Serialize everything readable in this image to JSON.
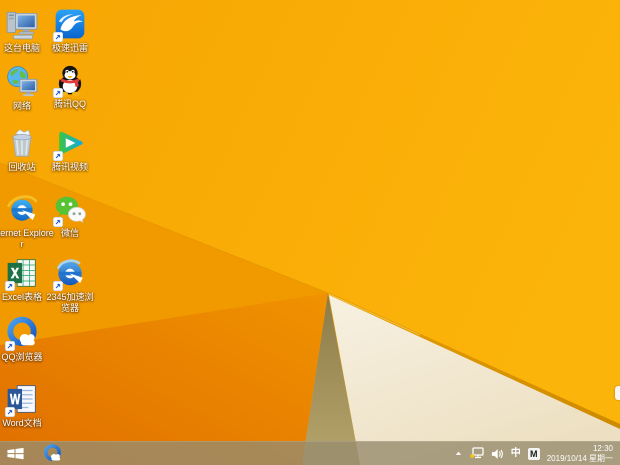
{
  "wallpaper": {
    "base_left": "#F7A502",
    "base_right": "#FBB40A",
    "left_wedge": "#F19A00",
    "left_dark_top": "#F09200",
    "left_dark_bottom": "#E06F00",
    "shadow_top": "#8C7B47",
    "shadow_bottom": "#B7A56D",
    "cream_top": "#F7F1E2",
    "cream_bottom": "#EDE0C2",
    "fold_strip_light": "#E89E00",
    "fold_strip_dark": "#CE8A00"
  },
  "desktop": {
    "icons": [
      {
        "label": "这台电脑",
        "icon": "computer-icon",
        "shortcut": false
      },
      {
        "label": "极速迅雷",
        "icon": "xunlei-icon",
        "shortcut": true
      },
      {
        "label": "网络",
        "icon": "network-icon",
        "shortcut": false
      },
      {
        "label": "腾讯QQ",
        "icon": "qq-icon",
        "shortcut": true
      },
      {
        "label": "回收站",
        "icon": "recycle-bin-icon",
        "shortcut": false
      },
      {
        "label": "腾讯视频",
        "icon": "tencent-video-icon",
        "shortcut": true
      },
      {
        "label": "Internet Explorer",
        "icon": "internet-explorer-icon",
        "shortcut": false
      },
      {
        "label": "微信",
        "icon": "wechat-icon",
        "shortcut": true
      },
      {
        "label": "Excel表格",
        "icon": "excel-icon",
        "shortcut": true
      },
      {
        "label": "2345加速浏览器",
        "icon": "2345-browser-icon",
        "shortcut": true
      },
      {
        "label": "QQ浏览器",
        "icon": "qq-browser-icon",
        "shortcut": true
      },
      {
        "label": "Word文档",
        "icon": "word-icon",
        "shortcut": true
      }
    ]
  },
  "taskbar": {
    "start_icon": "windows-start-icon",
    "pinned_icons": [
      "qq-browser-icon"
    ],
    "tray": {
      "hidden_icons_icon": "chevron-up-icon",
      "network_icon": "network-limited-icon",
      "volume_icon": "speaker-icon",
      "ime_mode": "中",
      "ime_badge": "M",
      "time": "12:30",
      "date": "2019/10/14 星期一"
    }
  }
}
